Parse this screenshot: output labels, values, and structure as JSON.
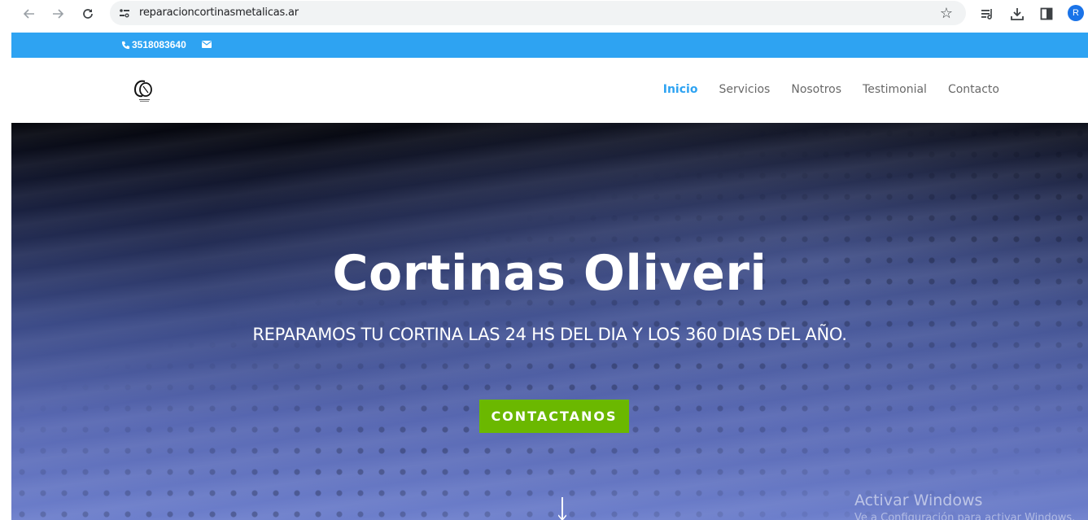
{
  "browser": {
    "url": "reparacioncortinasmetalicas.ar",
    "avatar_initial": "R"
  },
  "topbar": {
    "phone": "3518083640",
    "color": "#2ea3f2"
  },
  "header": {
    "menu": [
      {
        "label": "Inicio",
        "active": true
      },
      {
        "label": "Servicios"
      },
      {
        "label": "Nosotros"
      },
      {
        "label": "Testimonial"
      },
      {
        "label": "Contacto"
      }
    ]
  },
  "hero": {
    "title": "Cortinas Oliveri",
    "subtitle": "REPARAMOS TU CORTINA LAS 24 HS DEL DIA Y LOS 360 DIAS DEL AÑO.",
    "cta_label": "CONTACTANOS",
    "cta_color": "#6bb800"
  },
  "watermark": {
    "title": "Activar Windows",
    "subtitle": "Ve a Configuración para activar Windows."
  },
  "icons": [
    "back-arrow-icon",
    "forward-arrow-icon",
    "reload-icon",
    "site-info-icon",
    "star-icon",
    "reading-list-icon",
    "download-icon",
    "side-panel-icon",
    "phone-icon",
    "mail-icon",
    "logo",
    "scroll-down-icon"
  ]
}
